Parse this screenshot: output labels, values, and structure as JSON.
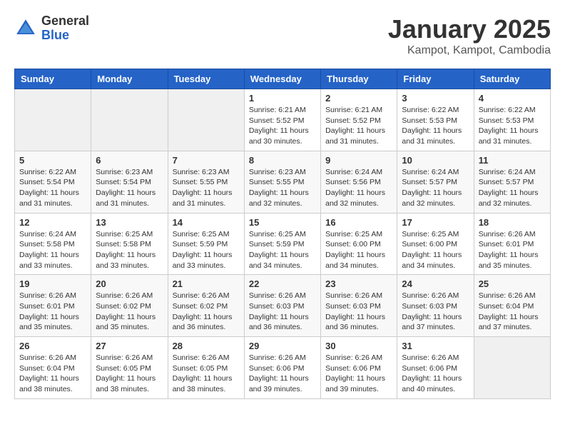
{
  "logo": {
    "general": "General",
    "blue": "Blue"
  },
  "header": {
    "title": "January 2025",
    "subtitle": "Kampot, Kampot, Cambodia"
  },
  "weekdays": [
    "Sunday",
    "Monday",
    "Tuesday",
    "Wednesday",
    "Thursday",
    "Friday",
    "Saturday"
  ],
  "weeks": [
    [
      {
        "day": "",
        "info": ""
      },
      {
        "day": "",
        "info": ""
      },
      {
        "day": "",
        "info": ""
      },
      {
        "day": "1",
        "info": "Sunrise: 6:21 AM\nSunset: 5:52 PM\nDaylight: 11 hours and 30 minutes."
      },
      {
        "day": "2",
        "info": "Sunrise: 6:21 AM\nSunset: 5:52 PM\nDaylight: 11 hours and 31 minutes."
      },
      {
        "day": "3",
        "info": "Sunrise: 6:22 AM\nSunset: 5:53 PM\nDaylight: 11 hours and 31 minutes."
      },
      {
        "day": "4",
        "info": "Sunrise: 6:22 AM\nSunset: 5:53 PM\nDaylight: 11 hours and 31 minutes."
      }
    ],
    [
      {
        "day": "5",
        "info": "Sunrise: 6:22 AM\nSunset: 5:54 PM\nDaylight: 11 hours and 31 minutes."
      },
      {
        "day": "6",
        "info": "Sunrise: 6:23 AM\nSunset: 5:54 PM\nDaylight: 11 hours and 31 minutes."
      },
      {
        "day": "7",
        "info": "Sunrise: 6:23 AM\nSunset: 5:55 PM\nDaylight: 11 hours and 31 minutes."
      },
      {
        "day": "8",
        "info": "Sunrise: 6:23 AM\nSunset: 5:55 PM\nDaylight: 11 hours and 32 minutes."
      },
      {
        "day": "9",
        "info": "Sunrise: 6:24 AM\nSunset: 5:56 PM\nDaylight: 11 hours and 32 minutes."
      },
      {
        "day": "10",
        "info": "Sunrise: 6:24 AM\nSunset: 5:57 PM\nDaylight: 11 hours and 32 minutes."
      },
      {
        "day": "11",
        "info": "Sunrise: 6:24 AM\nSunset: 5:57 PM\nDaylight: 11 hours and 32 minutes."
      }
    ],
    [
      {
        "day": "12",
        "info": "Sunrise: 6:24 AM\nSunset: 5:58 PM\nDaylight: 11 hours and 33 minutes."
      },
      {
        "day": "13",
        "info": "Sunrise: 6:25 AM\nSunset: 5:58 PM\nDaylight: 11 hours and 33 minutes."
      },
      {
        "day": "14",
        "info": "Sunrise: 6:25 AM\nSunset: 5:59 PM\nDaylight: 11 hours and 33 minutes."
      },
      {
        "day": "15",
        "info": "Sunrise: 6:25 AM\nSunset: 5:59 PM\nDaylight: 11 hours and 34 minutes."
      },
      {
        "day": "16",
        "info": "Sunrise: 6:25 AM\nSunset: 6:00 PM\nDaylight: 11 hours and 34 minutes."
      },
      {
        "day": "17",
        "info": "Sunrise: 6:25 AM\nSunset: 6:00 PM\nDaylight: 11 hours and 34 minutes."
      },
      {
        "day": "18",
        "info": "Sunrise: 6:26 AM\nSunset: 6:01 PM\nDaylight: 11 hours and 35 minutes."
      }
    ],
    [
      {
        "day": "19",
        "info": "Sunrise: 6:26 AM\nSunset: 6:01 PM\nDaylight: 11 hours and 35 minutes."
      },
      {
        "day": "20",
        "info": "Sunrise: 6:26 AM\nSunset: 6:02 PM\nDaylight: 11 hours and 35 minutes."
      },
      {
        "day": "21",
        "info": "Sunrise: 6:26 AM\nSunset: 6:02 PM\nDaylight: 11 hours and 36 minutes."
      },
      {
        "day": "22",
        "info": "Sunrise: 6:26 AM\nSunset: 6:03 PM\nDaylight: 11 hours and 36 minutes."
      },
      {
        "day": "23",
        "info": "Sunrise: 6:26 AM\nSunset: 6:03 PM\nDaylight: 11 hours and 36 minutes."
      },
      {
        "day": "24",
        "info": "Sunrise: 6:26 AM\nSunset: 6:03 PM\nDaylight: 11 hours and 37 minutes."
      },
      {
        "day": "25",
        "info": "Sunrise: 6:26 AM\nSunset: 6:04 PM\nDaylight: 11 hours and 37 minutes."
      }
    ],
    [
      {
        "day": "26",
        "info": "Sunrise: 6:26 AM\nSunset: 6:04 PM\nDaylight: 11 hours and 38 minutes."
      },
      {
        "day": "27",
        "info": "Sunrise: 6:26 AM\nSunset: 6:05 PM\nDaylight: 11 hours and 38 minutes."
      },
      {
        "day": "28",
        "info": "Sunrise: 6:26 AM\nSunset: 6:05 PM\nDaylight: 11 hours and 38 minutes."
      },
      {
        "day": "29",
        "info": "Sunrise: 6:26 AM\nSunset: 6:06 PM\nDaylight: 11 hours and 39 minutes."
      },
      {
        "day": "30",
        "info": "Sunrise: 6:26 AM\nSunset: 6:06 PM\nDaylight: 11 hours and 39 minutes."
      },
      {
        "day": "31",
        "info": "Sunrise: 6:26 AM\nSunset: 6:06 PM\nDaylight: 11 hours and 40 minutes."
      },
      {
        "day": "",
        "info": ""
      }
    ]
  ]
}
